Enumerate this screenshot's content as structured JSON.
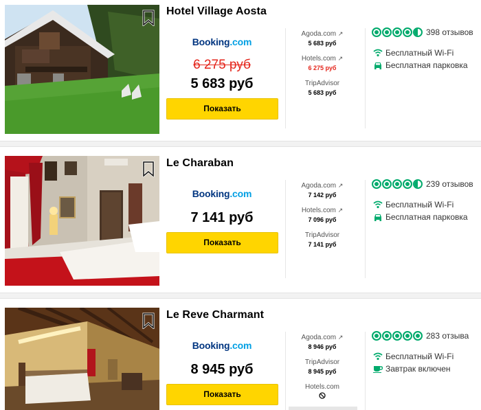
{
  "hotels": [
    {
      "name": "Hotel Village Aosta",
      "provider_logo": {
        "name": "Booking",
        "suffix": ".com"
      },
      "old_price": "6 275 руб",
      "price": "5 683 руб",
      "button": "Показать",
      "offers": [
        {
          "provider": "Agoda.com",
          "arrow": "↗",
          "price": "5 683 руб",
          "highlight": false
        },
        {
          "provider": "Hotels.com",
          "arrow": "↗",
          "price": "6 275 руб",
          "highlight": true
        },
        {
          "provider": "TripAdvisor",
          "arrow": "",
          "price": "5 683 руб",
          "highlight": false
        }
      ],
      "rating": 4.5,
      "reviews": "398 отзывов",
      "amenities": [
        {
          "icon": "wifi-icon",
          "label": "Бесплатный Wi-Fi"
        },
        {
          "icon": "car-icon",
          "label": "Бесплатная парковка"
        }
      ]
    },
    {
      "name": "Le Charaban",
      "provider_logo": {
        "name": "Booking",
        "suffix": ".com"
      },
      "old_price": "",
      "price": "7 141 руб",
      "button": "Показать",
      "offers": [
        {
          "provider": "Agoda.com",
          "arrow": "↗",
          "price": "7 142 руб",
          "highlight": false
        },
        {
          "provider": "Hotels.com",
          "arrow": "↗",
          "price": "7 096 руб",
          "highlight": false
        },
        {
          "provider": "TripAdvisor",
          "arrow": "",
          "price": "7 141 руб",
          "highlight": false
        }
      ],
      "rating": 4.5,
      "reviews": "239 отзывов",
      "amenities": [
        {
          "icon": "wifi-icon",
          "label": "Бесплатный Wi-Fi"
        },
        {
          "icon": "car-icon",
          "label": "Бесплатная парковка"
        }
      ]
    },
    {
      "name": "Le Reve Charmant",
      "provider_logo": {
        "name": "Booking",
        "suffix": ".com"
      },
      "old_price": "",
      "price": "8 945 руб",
      "button": "Показать",
      "offers": [
        {
          "provider": "Agoda.com",
          "arrow": "↗",
          "price": "8 946 руб",
          "highlight": false
        },
        {
          "provider": "TripAdvisor",
          "arrow": "",
          "price": "8 945 руб",
          "highlight": false
        },
        {
          "provider": "Hotels.com",
          "arrow": "",
          "price": "⃠",
          "highlight": false
        }
      ],
      "rating": 5,
      "reviews": "283 отзыва",
      "amenities": [
        {
          "icon": "wifi-icon",
          "label": "Бесплатный Wi-Fi"
        },
        {
          "icon": "breakfast-icon",
          "label": "Завтрак включен"
        }
      ]
    }
  ],
  "colors": {
    "accent_button": "#ffd500",
    "rating_green": "#00aa6c",
    "booking_blue": "#003580",
    "booking_light_blue": "#009fe3",
    "strike_red": "#e4251b"
  }
}
